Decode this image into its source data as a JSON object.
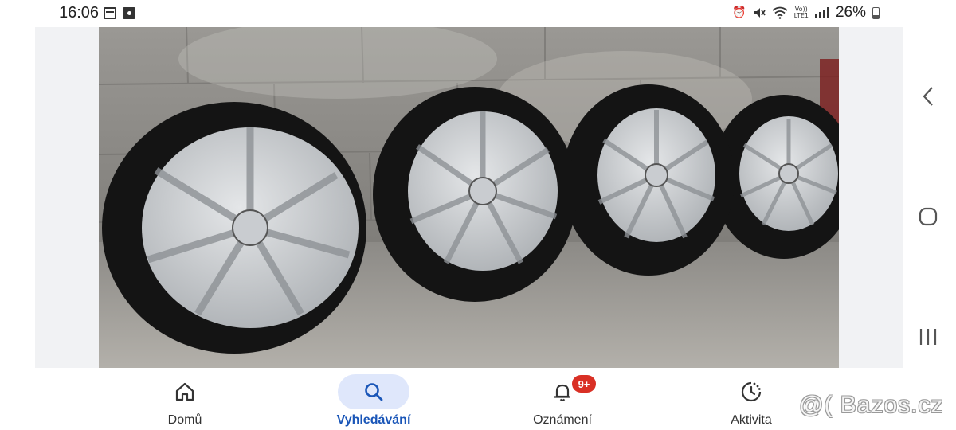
{
  "status_bar": {
    "time": "16:06",
    "left_icons": [
      "calendar-icon",
      "image-notification-icon"
    ],
    "right_icons": [
      "alarm-icon",
      "mute-icon",
      "wifi-icon",
      "volte-icon",
      "signal-icon",
      "battery-icon"
    ],
    "volte_line1": "Vo))",
    "volte_line2": "LTE1",
    "battery_percent": "26%"
  },
  "photo": {
    "subject": "four-alloy-wheels-with-tires",
    "icon": "photo-image"
  },
  "bottom_nav": {
    "items": [
      {
        "label": "Domů",
        "icon": "home-icon",
        "active": false
      },
      {
        "label": "Vyhledávání",
        "icon": "search-icon",
        "active": true
      },
      {
        "label": "Oznámení",
        "icon": "bell-icon",
        "active": false,
        "badge": "9+"
      },
      {
        "label": "Aktivita",
        "icon": "activity-icon",
        "active": false
      }
    ]
  },
  "android_nav": [
    "back-icon",
    "home-circle-icon",
    "recents-icon"
  ],
  "watermark": "@( Bazos.cz",
  "colors": {
    "accent": "#1a56b8",
    "active_pill": "#dfe7fb",
    "badge": "#d93025"
  }
}
